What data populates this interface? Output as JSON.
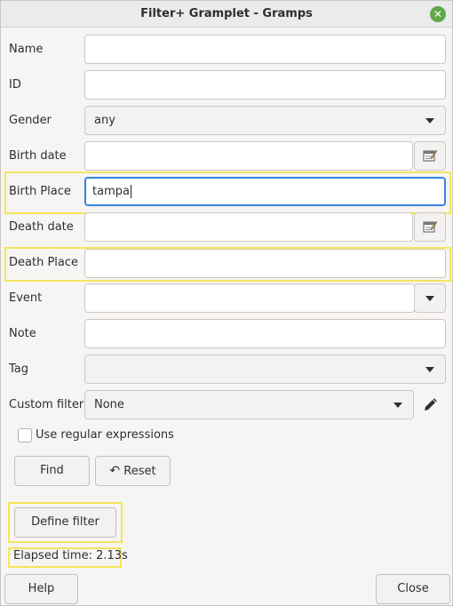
{
  "window": {
    "title": "Filter+ Gramplet - Gramps",
    "close_icon": "close-icon"
  },
  "form": {
    "name": {
      "label": "Name",
      "value": ""
    },
    "id": {
      "label": "ID",
      "value": ""
    },
    "gender": {
      "label": "Gender",
      "value": "any"
    },
    "birth_date": {
      "label": "Birth date",
      "value": ""
    },
    "birth_place": {
      "label": "Birth Place",
      "value": "tampa"
    },
    "death_date": {
      "label": "Death date",
      "value": ""
    },
    "death_place": {
      "label": "Death Place",
      "value": ""
    },
    "event": {
      "label": "Event",
      "value": ""
    },
    "note": {
      "label": "Note",
      "value": ""
    },
    "tag": {
      "label": "Tag",
      "value": ""
    },
    "custom_filter": {
      "label": "Custom filter",
      "value": "None"
    },
    "regex": {
      "label": "Use regular expressions",
      "checked": false
    }
  },
  "buttons": {
    "find": "Find",
    "reset": "Reset",
    "define_filter": "Define filter",
    "help": "Help",
    "close": "Close"
  },
  "status": {
    "elapsed": "Elapsed time: 2.13s"
  },
  "colors": {
    "focus": "#3584e4",
    "highlight": "#f4e55a",
    "close_button": "#62a84b"
  }
}
